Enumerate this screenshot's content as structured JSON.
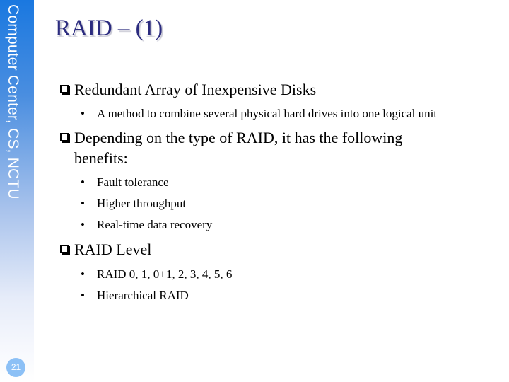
{
  "sidebar": {
    "label": "Computer Center, CS, NCTU",
    "page_number": "21"
  },
  "slide": {
    "title": "RAID – (1)",
    "bullets": [
      {
        "text": "Redundant Array of Inexpensive Disks",
        "sub": [
          "A method to combine several physical hard drives into one logical unit"
        ]
      },
      {
        "text": "Depending on the type of RAID, it has the following benefits:",
        "sub": [
          "Fault tolerance",
          "Higher throughput",
          "Real-time data recovery"
        ]
      },
      {
        "text": "RAID Level",
        "sub": [
          "RAID 0, 1, 0+1, 2, 3, 4, 5, 6",
          "Hierarchical RAID"
        ]
      }
    ]
  }
}
